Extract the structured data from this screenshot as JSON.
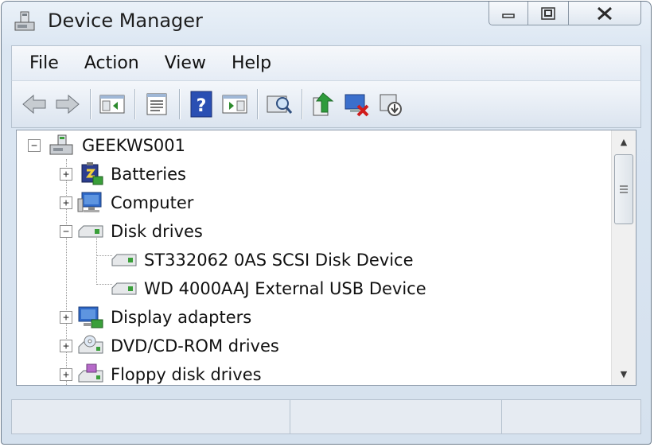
{
  "window": {
    "title": "Device Manager"
  },
  "menu": [
    "File",
    "Action",
    "View",
    "Help"
  ],
  "toolbar": {
    "buttons": [
      "back-arrow-icon",
      "forward-arrow-icon",
      "show-hide-console-tree-icon",
      "properties-icon",
      "help-icon",
      "show-action-pane-icon",
      "scan-hardware-changes-icon",
      "update-driver-icon",
      "uninstall-device-icon",
      "disable-device-icon"
    ]
  },
  "tree": {
    "root": "GEEKWS001",
    "nodes": [
      {
        "label": "Batteries",
        "expander": "+",
        "icon": "battery-icon"
      },
      {
        "label": "Computer",
        "expander": "+",
        "icon": "computer-icon"
      },
      {
        "label": "Disk drives",
        "expander": "−",
        "icon": "disk-drive-icon"
      },
      {
        "label": "ST332062 0AS SCSI Disk Device",
        "icon": "disk-drive-icon",
        "child": true
      },
      {
        "label": "WD 4000AAJ External USB Device",
        "icon": "disk-drive-icon",
        "child": true
      },
      {
        "label": "Display adapters",
        "expander": "+",
        "icon": "display-adapter-icon"
      },
      {
        "label": "DVD/CD-ROM drives",
        "expander": "+",
        "icon": "dvd-drive-icon"
      },
      {
        "label": "Floppy disk drives",
        "expander": "+",
        "icon": "floppy-drive-icon"
      }
    ]
  },
  "colors": {
    "accent": "#2a6fc9",
    "close_x": "#2b2b2b"
  }
}
